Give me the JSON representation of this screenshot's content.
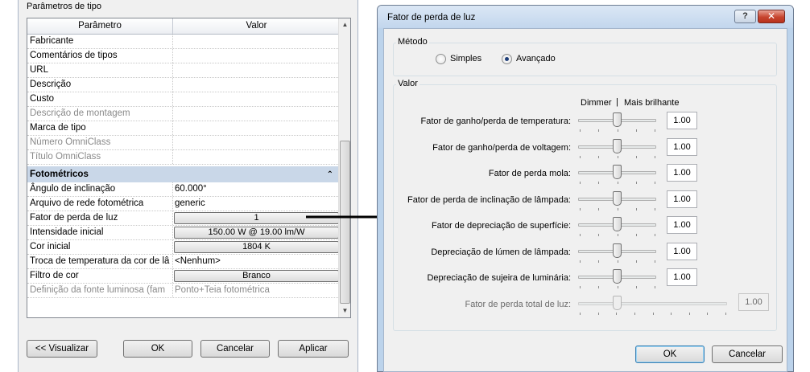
{
  "left": {
    "panel_title": "Parâmetros de tipo",
    "grid": {
      "col_param": "Parâmetro",
      "col_value": "Valor",
      "rows_top": [
        {
          "name": "Fabricante",
          "value": "",
          "disabled": false
        },
        {
          "name": "Comentários de tipos",
          "value": "",
          "disabled": false
        },
        {
          "name": "URL",
          "value": "",
          "disabled": false
        },
        {
          "name": "Descrição",
          "value": "",
          "disabled": false
        },
        {
          "name": "Custo",
          "value": "",
          "disabled": false
        },
        {
          "name": "Descrição de montagem",
          "value": "",
          "disabled": true
        },
        {
          "name": "Marca de tipo",
          "value": "",
          "disabled": false
        },
        {
          "name": "Número OmniClass",
          "value": "",
          "disabled": true
        },
        {
          "name": "Título OmniClass",
          "value": "",
          "disabled": true
        }
      ],
      "group_label": "Fotométricos",
      "group_arrow": "⌃",
      "rows_bottom": [
        {
          "name": "Ângulo de inclinação",
          "value": "60.000°",
          "button": false,
          "disabled": false
        },
        {
          "name": "Arquivo de rede fotométrica",
          "value": "generic",
          "button": false,
          "disabled": false
        },
        {
          "name": "Fator de perda de luz",
          "value": "1",
          "button": true,
          "disabled": false
        },
        {
          "name": "Intensidade inicial",
          "value": "150.00 W @ 19.00 lm/W",
          "button": true,
          "disabled": false
        },
        {
          "name": "Cor inicial",
          "value": "1804 K",
          "button": true,
          "disabled": false
        },
        {
          "name": "Troca de temperatura da cor de lâ",
          "value": "<Nenhum>",
          "button": false,
          "disabled": false
        },
        {
          "name": "Filtro de cor",
          "value": "Branco",
          "button": true,
          "disabled": false
        },
        {
          "name": "Definição da fonte luminosa (fam",
          "value": "Ponto+Teia fotométrica",
          "button": false,
          "disabled": true
        }
      ]
    },
    "buttons": {
      "preview": "<< Visualizar",
      "ok": "OK",
      "cancel": "Cancelar",
      "apply": "Aplicar"
    }
  },
  "dialog": {
    "title": "Fator de perda de luz",
    "help_label": "?",
    "close_label": "✕",
    "method": {
      "legend": "Método",
      "simple": "Simples",
      "advanced": "Avançado",
      "selected": "advanced"
    },
    "value": {
      "legend": "Valor",
      "head_dimmer": "Dimmer",
      "head_sep": "|",
      "head_brighter": "Mais brilhante",
      "sliders": [
        {
          "label": "Fator de ganho/perda de temperatura:",
          "value": "1.00",
          "level": 0.5,
          "disabled": false
        },
        {
          "label": "Fator de ganho/perda de voltagem:",
          "value": "1.00",
          "level": 0.5,
          "disabled": false
        },
        {
          "label": "Fator de perda mola:",
          "value": "1.00",
          "level": 0.5,
          "disabled": false
        },
        {
          "label": "Fator de perda de inclinação de lâmpada:",
          "value": "1.00",
          "level": 0.5,
          "disabled": false
        },
        {
          "label": "Fator de depreciação de superfície:",
          "value": "1.00",
          "level": 0.5,
          "disabled": false
        },
        {
          "label": "Depreciação de lúmen de lâmpada:",
          "value": "1.00",
          "level": 0.5,
          "disabled": false
        },
        {
          "label": "Depreciação de sujeira de luminária:",
          "value": "1.00",
          "level": 0.5,
          "disabled": false
        },
        {
          "label": "Fator de perda total de luz:",
          "value": "1.00",
          "level": 0.25,
          "disabled": true
        }
      ]
    },
    "buttons": {
      "ok": "OK",
      "cancel": "Cancelar"
    }
  }
}
